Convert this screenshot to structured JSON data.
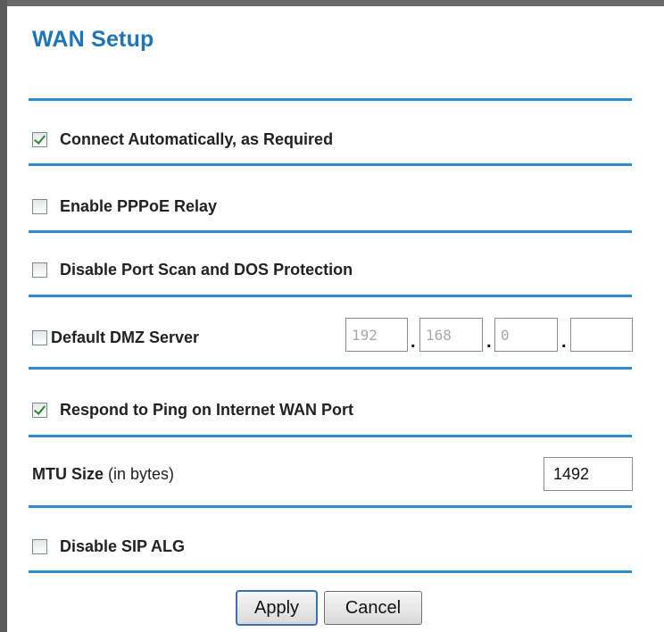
{
  "page": {
    "title": "WAN Setup"
  },
  "options": {
    "connect_auto": {
      "label": "Connect Automatically, as Required",
      "checked": true
    },
    "pppoe_relay": {
      "label": "Enable PPPoE Relay",
      "checked": false
    },
    "disable_port_scan": {
      "label": "Disable Port Scan and DOS Protection",
      "checked": false
    },
    "dmz": {
      "label": "Default DMZ Server",
      "checked": false,
      "ip": [
        "192",
        "168",
        "0",
        ""
      ],
      "separator": "."
    },
    "respond_ping": {
      "label": "Respond to Ping on Internet WAN Port",
      "checked": true
    },
    "mtu": {
      "label": "MTU Size",
      "note": "(in bytes)",
      "value": "1492"
    },
    "disable_sip_alg": {
      "label": "Disable SIP ALG",
      "checked": false
    }
  },
  "buttons": {
    "apply": "Apply",
    "cancel": "Cancel"
  },
  "colors": {
    "title": "#1f74b8",
    "divider": "#2c8ed0",
    "checkmark": "#2a8a2a"
  }
}
